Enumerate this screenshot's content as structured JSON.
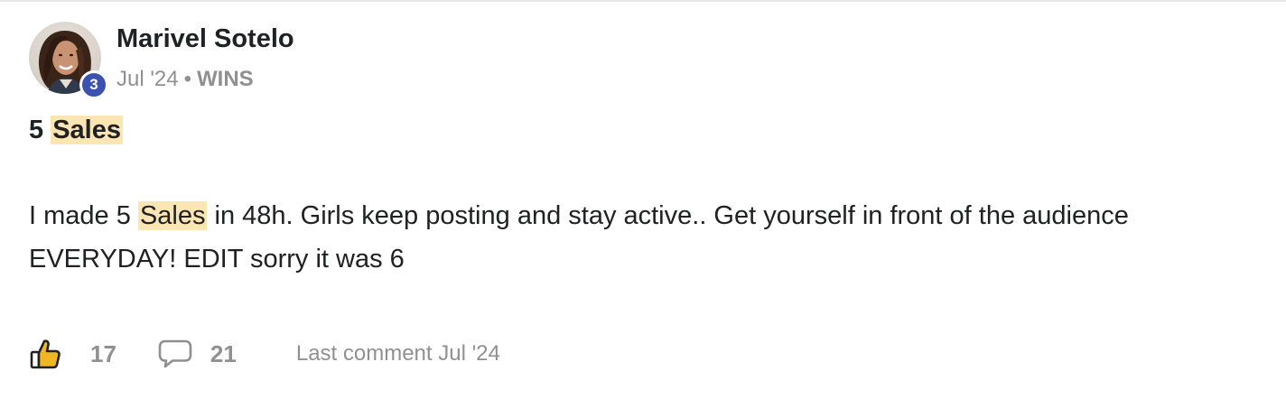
{
  "author": {
    "name": "Marivel Sotelo",
    "level": "3"
  },
  "meta": {
    "date": "Jul '24",
    "separator": "•",
    "category": "WINS"
  },
  "post": {
    "title_prefix": "5",
    "title_highlight": "Sales",
    "body_line1_prefix": "I made 5",
    "body_line1_highlight": "Sales",
    "body_line1_suffix": "in 48h. Girls keep posting and stay active.. Get yourself in front of the audience",
    "body_line2": "EVERYDAY! EDIT sorry it was 6"
  },
  "footer": {
    "likes": "17",
    "comments": "21",
    "last_comment": "Last comment Jul '24"
  },
  "colors": {
    "highlight": "#fbe6b3",
    "badge": "#3c52b0",
    "like_icon": "#f2b526",
    "muted_text": "#909090"
  },
  "icons": {
    "like": "thumbs-up-icon",
    "comment": "speech-bubble-icon"
  }
}
